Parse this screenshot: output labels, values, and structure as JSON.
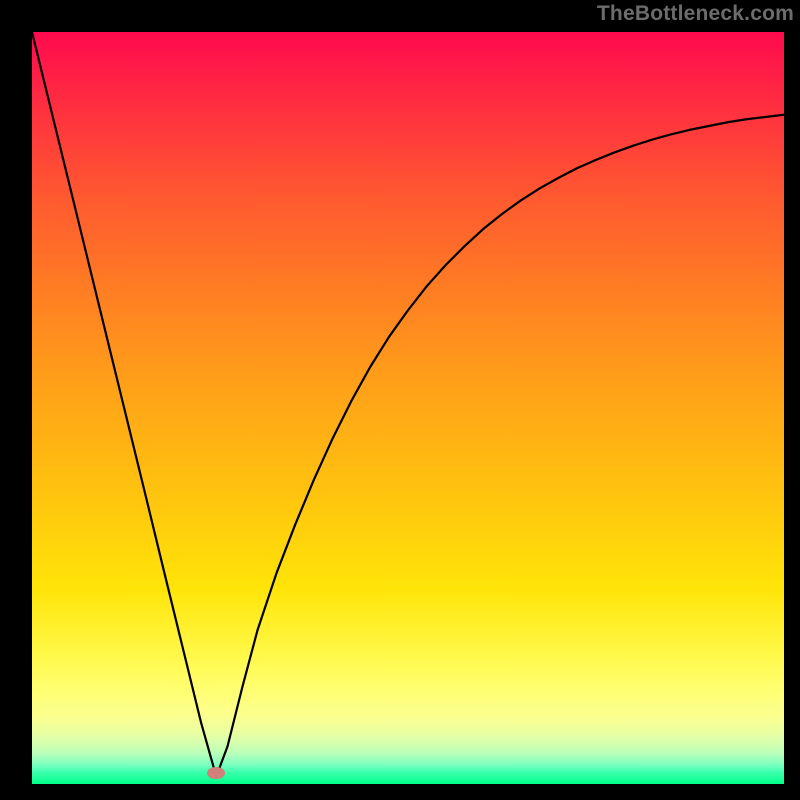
{
  "watermark": {
    "text": "TheBottleneck.com"
  },
  "chart_data": {
    "type": "line",
    "title": "",
    "xlabel": "",
    "ylabel": "",
    "xlim": [
      0,
      100
    ],
    "ylim": [
      0,
      100
    ],
    "grid": false,
    "legend": false,
    "minimum_marker": {
      "x": 24.5,
      "y": 1.5
    },
    "series": [
      {
        "name": "bottleneck-curve",
        "x": [
          0.0,
          2.5,
          5.0,
          7.5,
          10.0,
          12.5,
          15.0,
          17.5,
          20.0,
          22.5,
          24.5,
          26.0,
          28.0,
          30.0,
          32.5,
          35.0,
          37.5,
          40.0,
          42.5,
          45.0,
          47.5,
          50.0,
          52.5,
          55.0,
          57.5,
          60.0,
          62.5,
          65.0,
          67.5,
          70.0,
          72.5,
          75.0,
          77.5,
          80.0,
          82.5,
          85.0,
          87.5,
          90.0,
          92.5,
          95.0,
          97.5,
          100.0
        ],
        "y": [
          100.0,
          89.8,
          79.6,
          69.4,
          59.2,
          49.0,
          38.8,
          28.5,
          18.3,
          8.1,
          1.0,
          5.0,
          13.0,
          20.5,
          28.0,
          34.5,
          40.5,
          46.0,
          51.0,
          55.5,
          59.5,
          63.0,
          66.2,
          69.0,
          71.5,
          73.8,
          75.8,
          77.6,
          79.2,
          80.6,
          81.9,
          83.0,
          84.0,
          84.9,
          85.7,
          86.4,
          87.0,
          87.5,
          88.0,
          88.4,
          88.7,
          89.0
        ]
      }
    ],
    "background": {
      "type": "vertical-gradient",
      "top_color": "#ff0a4e",
      "bottom_color": "#00ff88"
    }
  }
}
